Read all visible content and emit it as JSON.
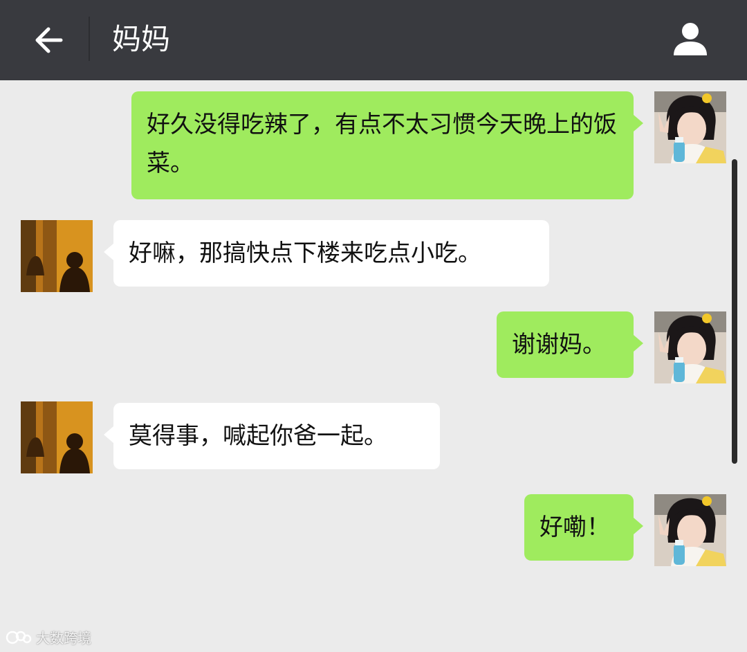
{
  "header": {
    "back_icon": "arrow-left-icon",
    "title": "妈妈",
    "profile_icon": "person-icon"
  },
  "colors": {
    "topbar": "#393a3f",
    "chat_background": "#ebebeb",
    "outgoing_bubble": "#9feb5e",
    "incoming_bubble": "#ffffff"
  },
  "messages": [
    {
      "sender": "me",
      "text": "好久没得吃辣了，有点不太习惯今天晚上的饭菜。"
    },
    {
      "sender": "mom",
      "text": "好嘛，那搞快点下楼来吃点小吃。"
    },
    {
      "sender": "me",
      "text": "谢谢妈。"
    },
    {
      "sender": "mom",
      "text": "莫得事，喊起你爸一起。"
    },
    {
      "sender": "me",
      "text": "好嘞！"
    }
  ],
  "watermark": {
    "text": "大数跨境"
  }
}
